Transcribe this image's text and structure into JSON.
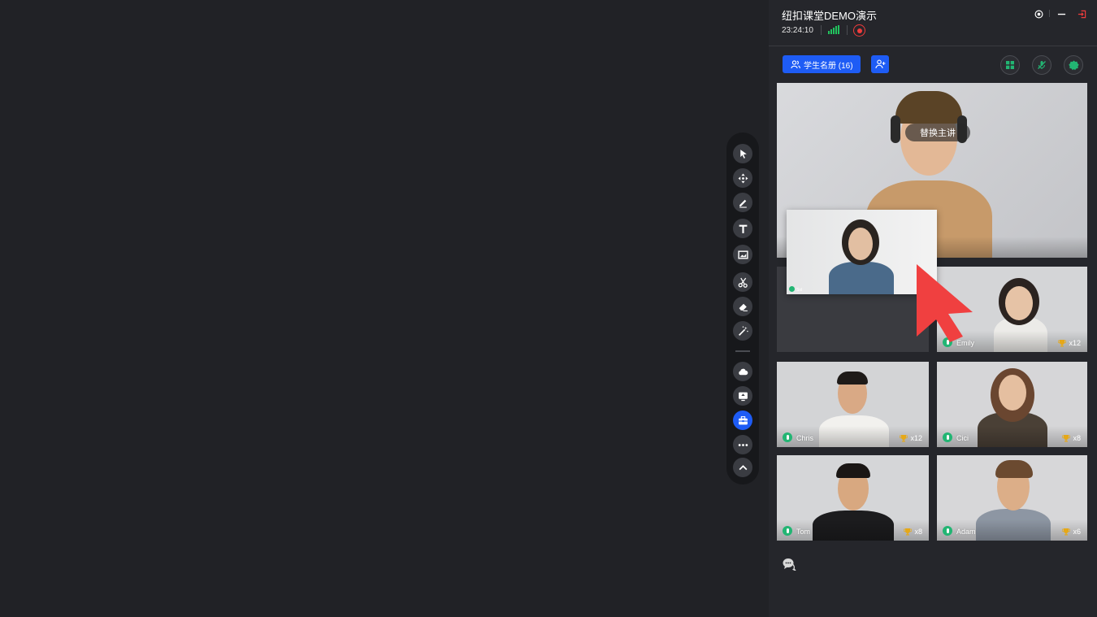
{
  "header": {
    "title": "纽扣课堂DEMO演示",
    "time": "23:24:10"
  },
  "toolbar": {
    "tools": [
      "pointer-icon",
      "move-icon",
      "pen-icon",
      "text-icon",
      "image-icon",
      "scissors-icon",
      "eraser-icon",
      "magic-wand-icon",
      "cloud-icon",
      "screen-share-icon",
      "toolbox-icon",
      "more-icon",
      "collapse-icon"
    ],
    "active_tool": "toolbox-icon"
  },
  "panel": {
    "roster_label": "学生名册 (16)",
    "teacher_tile": {
      "overlay_label": "替换主讲"
    },
    "students": [
      {
        "name": "Emily",
        "trophies": "x12"
      },
      {
        "name": "Chris",
        "trophies": "x12"
      },
      {
        "name": "Cici",
        "trophies": "x8"
      },
      {
        "name": "Tom",
        "trophies": "x8"
      },
      {
        "name": "Adam",
        "trophies": "x6"
      }
    ],
    "dragging_tile": {
      "name": "Sol"
    }
  },
  "colors": {
    "accent": "#1e5cf5",
    "mic": "#22b573",
    "signal": "#22c35e",
    "record": "#f03c3c",
    "trophy": "#e6a817",
    "cursor": "#f04040"
  }
}
